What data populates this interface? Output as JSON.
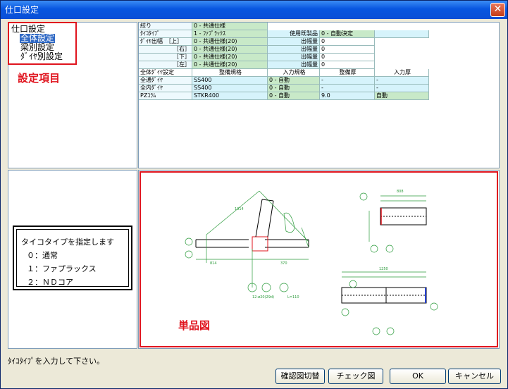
{
  "window": {
    "title": "仕口設定"
  },
  "tree": {
    "root": "仕口設定",
    "items": [
      "全体設定",
      "梁別設定",
      "ﾀﾞｲﾔ別設定"
    ],
    "annotation": "設定項目"
  },
  "grid": {
    "rows": [
      [
        "絞り",
        "0 - 共通仕様",
        "",
        "",
        "",
        ""
      ],
      [
        "ﾀｲｺﾀｲﾌﾟ",
        "1 - ﾌｧﾌﾟﾗｯｸｽ",
        "使用既製品",
        "0 - 自動決定",
        "",
        ""
      ],
      [
        "ﾀﾞｲﾔ出幅　［上］",
        "0 - 共通仕様(20)",
        "出幅量",
        "0",
        "",
        ""
      ],
      [
        "［右］",
        "0 - 共通仕様(20)",
        "出幅量",
        "0",
        "",
        ""
      ],
      [
        "［下］",
        "0 - 共通仕様(20)",
        "出幅量",
        "0",
        "",
        ""
      ],
      [
        "［左］",
        "0 - 共通仕様(20)",
        "出幅量",
        "0",
        "",
        ""
      ]
    ],
    "header": [
      "全体ﾀﾞｲﾔ設定",
      "整備規格",
      "入力規格",
      "整備厚",
      "入力厚"
    ],
    "rows2": [
      [
        "全通ﾀﾞｲﾔ",
        "SS400",
        "0 - 自動",
        "-",
        "-"
      ],
      [
        "全内ﾀﾞｲﾔ",
        "SS400",
        "0 - 自動",
        "-",
        "-"
      ],
      [
        "PZｺﾗﾑ",
        "STKR400",
        "0 - 自動",
        "9.0",
        "自動"
      ]
    ]
  },
  "description": {
    "title": "タイコタイプを指定します",
    "lines": [
      "０：通常",
      "１：ファプラックス",
      "２：ＮＤコア"
    ]
  },
  "drawing": {
    "annotation": "単品図"
  },
  "status_text": "ﾀｲｺﾀｲﾌﾟを入力して下さい。",
  "buttons": {
    "toggle": "確認図切替",
    "check": "チェック図",
    "ok": "OK",
    "cancel": "キャンセル"
  },
  "colors": {
    "highlight": "#e0141e",
    "accent_green": "#c8e9c8",
    "accent_cyan": "#d6f3fb"
  }
}
